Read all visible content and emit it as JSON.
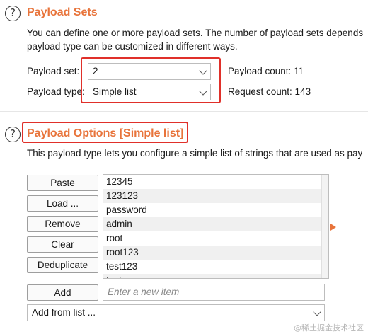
{
  "payload_sets": {
    "title": "Payload Sets",
    "description_line1": "You can define one or more payload sets. The number of payload sets depends",
    "description_line2": "payload type can be customized in different ways.",
    "payload_set_label": "Payload set:",
    "payload_set_value": "2",
    "payload_type_label": "Payload type:",
    "payload_type_value": "Simple list",
    "payload_count": "Payload count: 11",
    "request_count": "Request count: 143"
  },
  "payload_options": {
    "title": "Payload Options [Simple list]",
    "description": "This payload type lets you configure a simple list of strings that are used as pay",
    "buttons": {
      "paste": "Paste",
      "load": "Load ...",
      "remove": "Remove",
      "clear": "Clear",
      "deduplicate": "Deduplicate",
      "add": "Add"
    },
    "items": [
      "12345",
      "123123",
      "password",
      "admin",
      "root",
      "root123",
      "test123",
      "test"
    ],
    "new_item_placeholder": "Enter a new item",
    "add_from_list": "Add from list ..."
  },
  "icons": {
    "help": "help-circle-icon",
    "expand_arrow": "triangle-right-icon",
    "chevron": "chevron-down-icon"
  },
  "colors": {
    "section_title": "#e8743b",
    "highlight_box": "#e0302a"
  },
  "watermark": "@稀土掘金技术社区"
}
